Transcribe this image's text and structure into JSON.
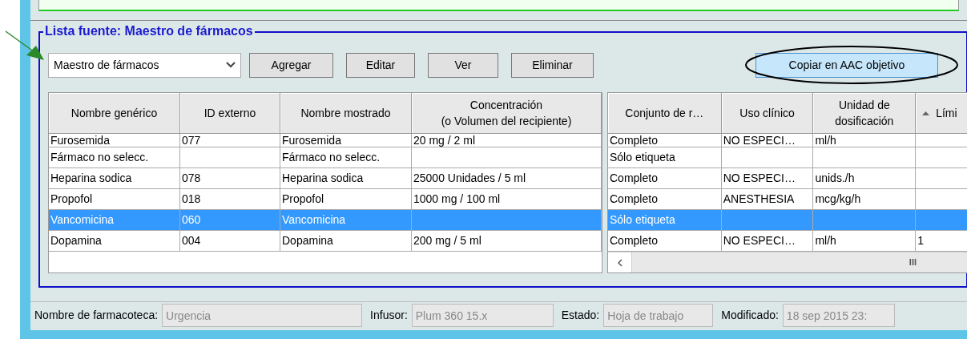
{
  "group_title": "Lista fuente: Maestro de fármacos",
  "source_dropdown": {
    "value": "Maestro de fármacos"
  },
  "buttons": [
    {
      "label": "Agregar",
      "highlighted": false
    },
    {
      "label": "Editar",
      "highlighted": false
    },
    {
      "label": "Ver",
      "highlighted": false
    },
    {
      "label": "Eliminar",
      "highlighted": false
    },
    {
      "label": "Copiar en AAC objetivo",
      "highlighted": true
    }
  ],
  "left_table": {
    "columns": [
      "Nombre genérico",
      "ID externo",
      "Nombre mostrado",
      "Concentración\n(o Volumen del recipiente)"
    ],
    "rows": [
      {
        "selected": false,
        "cells": [
          "Furosemida",
          "077",
          "Furosemida",
          "20 mg / 2 ml"
        ]
      },
      {
        "selected": false,
        "cells": [
          "Fármaco no selecc.",
          "",
          "Fármaco no selecc.",
          ""
        ]
      },
      {
        "selected": false,
        "cells": [
          "Heparina sodica",
          "078",
          "Heparina sodica",
          "25000 Unidades / 5 ml"
        ]
      },
      {
        "selected": false,
        "cells": [
          "Propofol",
          "018",
          "Propofol",
          "1000 mg / 100 ml"
        ]
      },
      {
        "selected": true,
        "cells": [
          "Vancomicina",
          "060",
          "Vancomicina",
          ""
        ]
      },
      {
        "selected": false,
        "cells": [
          "Dopamina",
          "004",
          "Dopamina",
          "200 mg / 5 ml"
        ]
      }
    ]
  },
  "right_table": {
    "columns": [
      {
        "label": "Conjunto de r…",
        "sorted": false
      },
      {
        "label": "Uso clínico",
        "sorted": false
      },
      {
        "label": "Unidad de\ndosificación",
        "sorted": false
      },
      {
        "label": "Lími",
        "sorted": true
      }
    ],
    "rows": [
      {
        "selected": false,
        "cells": [
          "Completo",
          "NO ESPECI…",
          "ml/h",
          ""
        ]
      },
      {
        "selected": false,
        "cells": [
          "Sólo etiqueta",
          "",
          "",
          ""
        ]
      },
      {
        "selected": false,
        "cells": [
          "Completo",
          "NO ESPECI…",
          "unids./h",
          ""
        ]
      },
      {
        "selected": false,
        "cells": [
          "Completo",
          "ANESTHESIA",
          "mcg/kg/h",
          ""
        ]
      },
      {
        "selected": true,
        "cells": [
          "Sólo etiqueta",
          "",
          "",
          ""
        ]
      },
      {
        "selected": false,
        "cells": [
          "Completo",
          "NO ESPECI…",
          "ml/h",
          "1"
        ]
      }
    ],
    "scrollbar": {
      "thumb": "III"
    }
  },
  "status_bar": [
    {
      "label": "Nombre de farmacoteca:",
      "value": "Urgencia",
      "disabled": true
    },
    {
      "label": "Infusor:",
      "value": "Plum 360 15.x",
      "disabled": true
    },
    {
      "label": "Estado:",
      "value": "Hoja de trabajo",
      "disabled": true
    },
    {
      "label": "Modificado:",
      "value": "18 sep 2015 23:",
      "disabled": true
    }
  ]
}
